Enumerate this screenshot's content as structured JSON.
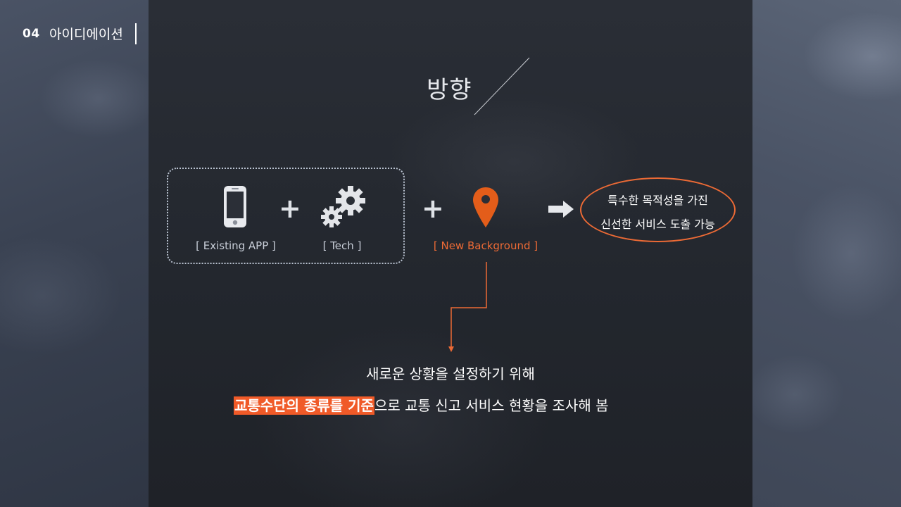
{
  "section": {
    "number": "04",
    "title": "아이디에이션"
  },
  "heading": "방향",
  "flow": {
    "app_caption": "[ Existing APP ]",
    "tech_caption": "[ Tech ]",
    "background_caption": "[ New Background ]",
    "plus_symbol": "+",
    "result_line1": "특수한 목적성을 가진",
    "result_line2": "신선한 서비스 도출 가능",
    "icons": [
      "smartphone-icon",
      "gears-icon",
      "location-pin-icon",
      "arrow-right-icon"
    ]
  },
  "conclusion": {
    "line1": "새로운 상황을 설정하기 위해",
    "line2_highlight": "교통수단의 종류를 기준",
    "line2_rest": "으로 교통 신고 서비스 현황을 조사해 봄"
  },
  "colors": {
    "accent": "#ec6a35",
    "highlight": "#f05a28",
    "text": "#ffffff",
    "panel": "#23272e"
  }
}
